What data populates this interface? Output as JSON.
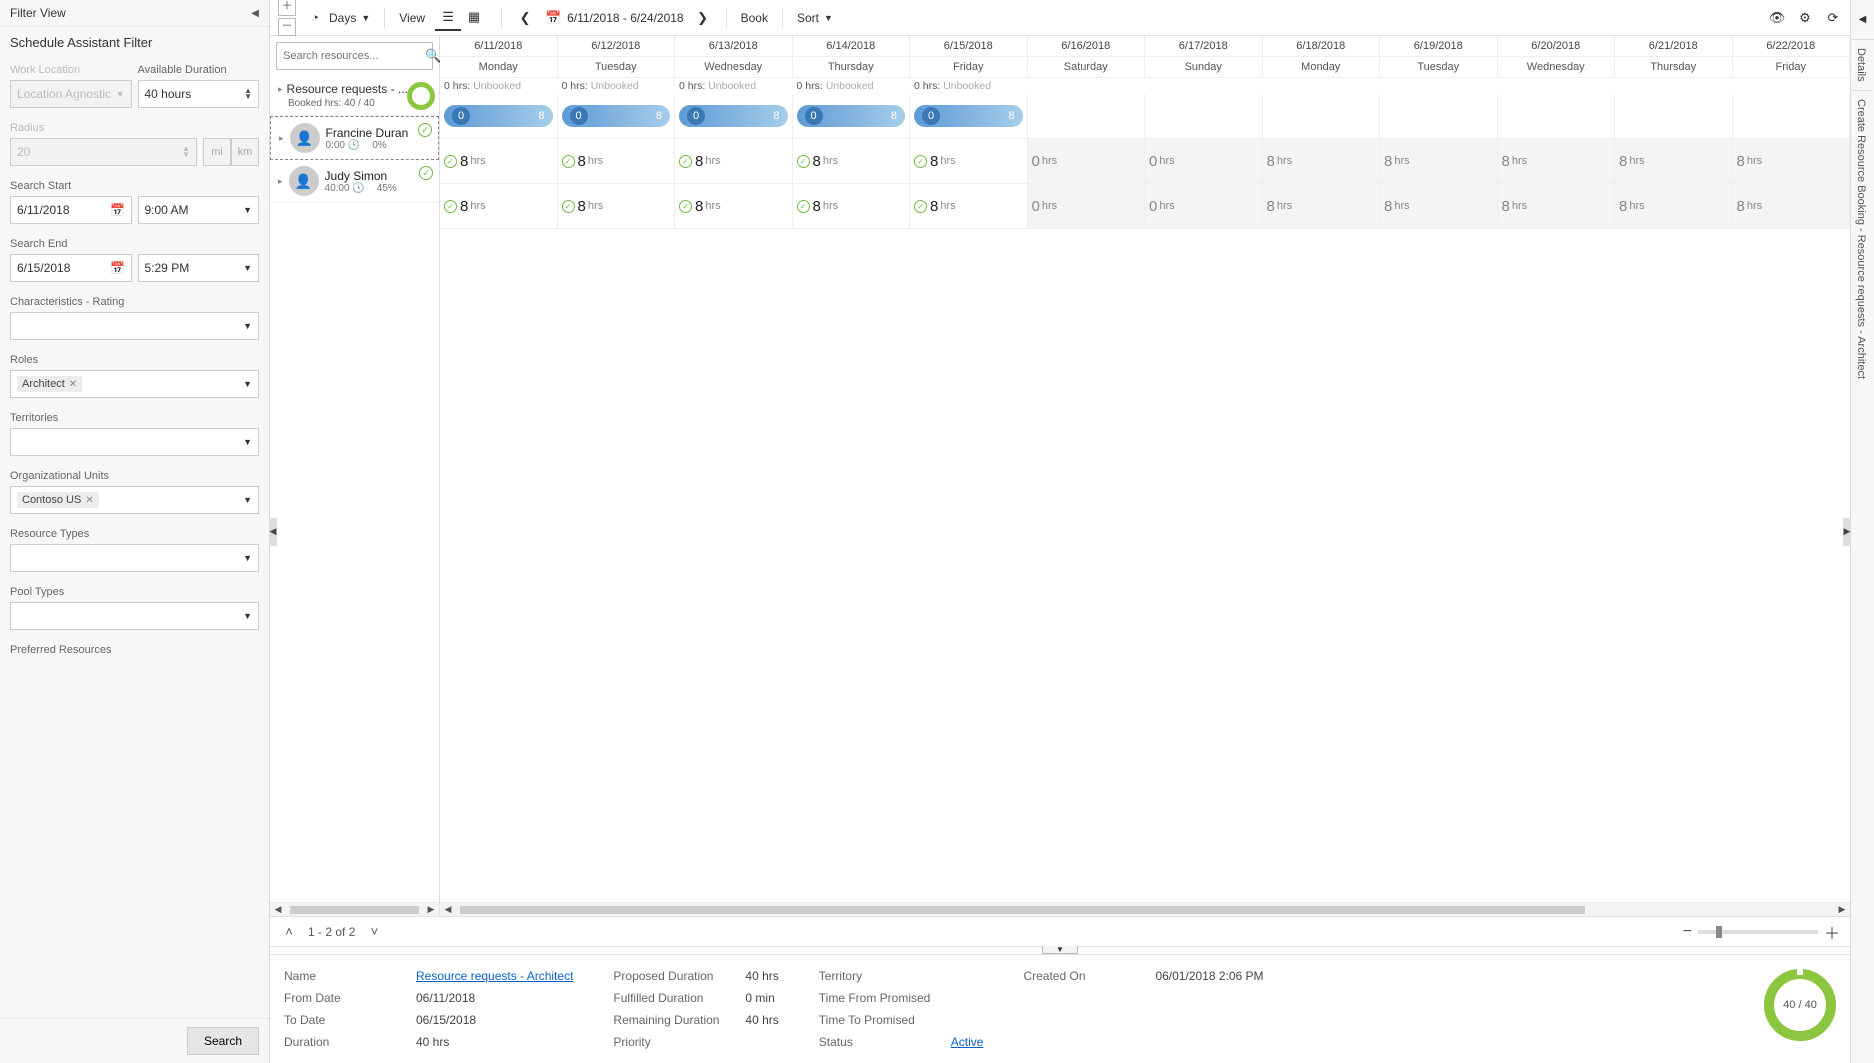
{
  "sidebar": {
    "pane_title": "Filter View",
    "subtitle": "Schedule Assistant Filter",
    "work_location_label": "Work Location",
    "work_location_value": "Location Agnostic",
    "available_duration_label": "Available Duration",
    "available_duration_value": "40 hours",
    "radius_label": "Radius",
    "radius_value": "20",
    "radius_mi": "mi",
    "radius_km": "km",
    "search_start_label": "Search Start",
    "search_start_date": "6/11/2018",
    "search_start_time": "9:00 AM",
    "search_end_label": "Search End",
    "search_end_date": "6/15/2018",
    "search_end_time": "5:29 PM",
    "characteristics_label": "Characteristics - Rating",
    "roles_label": "Roles",
    "roles_chip": "Architect",
    "territories_label": "Territories",
    "org_units_label": "Organizational Units",
    "org_units_chip": "Contoso US",
    "resource_types_label": "Resource Types",
    "pool_types_label": "Pool Types",
    "preferred_resources_label": "Preferred Resources",
    "search_btn": "Search"
  },
  "toolbar": {
    "days": "Days",
    "view": "View",
    "date_range": "6/11/2018 - 6/24/2018",
    "book": "Book",
    "sort": "Sort"
  },
  "search_resources_placeholder": "Search resources...",
  "request_header": {
    "title": "Resource requests - ...",
    "booked": "Booked hrs: 40 / 40"
  },
  "resources": [
    {
      "name": "Francine Duran",
      "time": "0:00",
      "pct": "0%",
      "selected": true
    },
    {
      "name": "Judy Simon",
      "time": "40:00",
      "pct": "45%",
      "selected": false
    }
  ],
  "days": [
    {
      "date": "6/11/2018",
      "dow": "Monday",
      "unbooked": "0 hrs:",
      "ub2": "Unbooked",
      "pill_l": "0",
      "pill_r": "8",
      "avail": "8",
      "zero": false
    },
    {
      "date": "6/12/2018",
      "dow": "Tuesday",
      "unbooked": "0 hrs:",
      "ub2": "Unbooked",
      "pill_l": "0",
      "pill_r": "8",
      "avail": "8",
      "zero": false
    },
    {
      "date": "6/13/2018",
      "dow": "Wednesday",
      "unbooked": "0 hrs:",
      "ub2": "Unbooked",
      "pill_l": "0",
      "pill_r": "8",
      "avail": "8",
      "zero": false
    },
    {
      "date": "6/14/2018",
      "dow": "Thursday",
      "unbooked": "0 hrs:",
      "ub2": "Unbooked",
      "pill_l": "0",
      "pill_r": "8",
      "avail": "8",
      "zero": false
    },
    {
      "date": "6/15/2018",
      "dow": "Friday",
      "unbooked": "0 hrs:",
      "ub2": "Unbooked",
      "pill_l": "0",
      "pill_r": "8",
      "avail": "8",
      "zero": false
    },
    {
      "date": "6/16/2018",
      "dow": "Saturday",
      "unbooked": "",
      "ub2": "",
      "pill_l": "",
      "pill_r": "",
      "avail": "0",
      "zero": true
    },
    {
      "date": "6/17/2018",
      "dow": "Sunday",
      "unbooked": "",
      "ub2": "",
      "pill_l": "",
      "pill_r": "",
      "avail": "0",
      "zero": true
    },
    {
      "date": "6/18/2018",
      "dow": "Monday",
      "unbooked": "",
      "ub2": "",
      "pill_l": "",
      "pill_r": "",
      "avail": "8",
      "zero": false,
      "gray": true
    },
    {
      "date": "6/19/2018",
      "dow": "Tuesday",
      "unbooked": "",
      "ub2": "",
      "pill_l": "",
      "pill_r": "",
      "avail": "8",
      "zero": false,
      "gray": true
    },
    {
      "date": "6/20/2018",
      "dow": "Wednesday",
      "unbooked": "",
      "ub2": "",
      "pill_l": "",
      "pill_r": "",
      "avail": "8",
      "zero": false,
      "gray": true
    },
    {
      "date": "6/21/2018",
      "dow": "Thursday",
      "unbooked": "",
      "ub2": "",
      "pill_l": "",
      "pill_r": "",
      "avail": "8",
      "zero": false,
      "gray": true
    },
    {
      "date": "6/22/2018",
      "dow": "Friday",
      "unbooked": "",
      "ub2": "",
      "pill_l": "",
      "pill_r": "",
      "avail": "8",
      "zero": false,
      "gray": true
    }
  ],
  "hrs_label": "hrs",
  "paging": {
    "text": "1 - 2 of 2"
  },
  "details": {
    "name_k": "Name",
    "name_v": "Resource requests - Architect",
    "from_k": "From Date",
    "from_v": "06/11/2018",
    "to_k": "To Date",
    "to_v": "06/15/2018",
    "dur_k": "Duration",
    "dur_v": "40 hrs",
    "pdur_k": "Proposed Duration",
    "pdur_v": "40 hrs",
    "fdur_k": "Fulfilled Duration",
    "fdur_v": "0 min",
    "rdur_k": "Remaining Duration",
    "rdur_v": "40 hrs",
    "prio_k": "Priority",
    "prio_v": "",
    "terr_k": "Territory",
    "terr_v": "",
    "tfp_k": "Time From Promised",
    "tfp_v": "",
    "ttp_k": "Time To Promised",
    "ttp_v": "",
    "stat_k": "Status",
    "stat_v": "Active",
    "created_k": "Created On",
    "created_v": "06/01/2018 2:06 PM",
    "donut": "40 / 40"
  },
  "right_rail": {
    "details": "Details",
    "long": "Create Resource Booking - Resource requests - Architect"
  }
}
